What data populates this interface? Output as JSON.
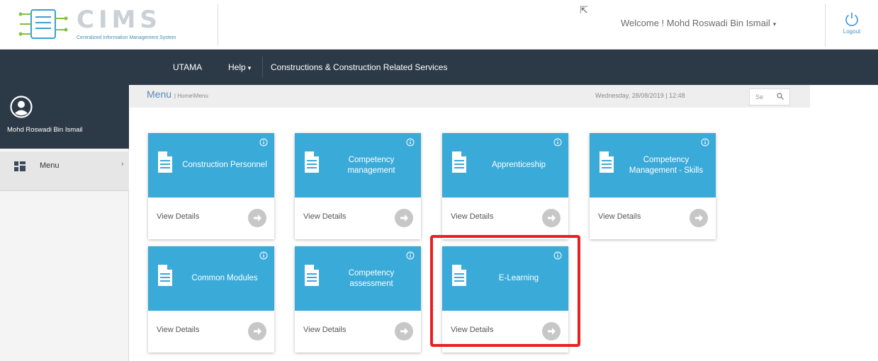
{
  "header": {
    "logo_word": "CIMS",
    "logo_subtitle": "Centralized Information Management System",
    "welcome": "Welcome ! Mohd Roswadi Bin Ismail",
    "logout_label": "Logout"
  },
  "nav": {
    "items": [
      "UTAMA",
      "Help",
      "Constructions & Construction Related Services"
    ]
  },
  "sidebar": {
    "user_name": "Mohd Roswadi Bin Ismail",
    "menu_label": "Menu"
  },
  "breadcrumb": {
    "title": "Menu",
    "path": "| Home\\Menu",
    "datetime": "Wednesday, 28/08/2019 | 12:48",
    "search_placeholder": "Se"
  },
  "tiles": [
    {
      "title": "Construction Personnel",
      "action": "View Details"
    },
    {
      "title": "Competency management",
      "action": "View Details"
    },
    {
      "title": "Apprenticeship",
      "action": "View Details"
    },
    {
      "title": "Competency Management - Skills",
      "action": "View Details"
    },
    {
      "title": "Common Modules",
      "action": "View Details"
    },
    {
      "title": "Competency assessment",
      "action": "View Details"
    },
    {
      "title": "E-Learning",
      "action": "View Details"
    }
  ],
  "colors": {
    "navbar": "#2c3a47",
    "tile": "#3aaad9",
    "highlight": "#e8201f"
  }
}
